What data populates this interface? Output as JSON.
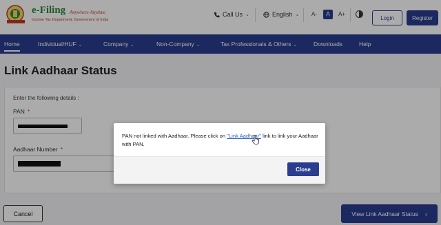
{
  "header": {
    "logo_title": "e-Filing",
    "logo_tagline": "Anywhere Anytime",
    "logo_subtitle": "Income Tax Department, Government of India",
    "call_us": "Call Us",
    "language": "English",
    "font_decrease": "A-",
    "font_normal": "A",
    "font_increase": "A+",
    "login": "Login",
    "register": "Register"
  },
  "nav": {
    "items": [
      {
        "label": "Home",
        "has_menu": false
      },
      {
        "label": "Individual/HUF",
        "has_menu": true
      },
      {
        "label": "Company",
        "has_menu": true
      },
      {
        "label": "Non-Company",
        "has_menu": true
      },
      {
        "label": "Tax Professionals & Others",
        "has_menu": true
      },
      {
        "label": "Downloads",
        "has_menu": false
      },
      {
        "label": "Help",
        "has_menu": false
      }
    ]
  },
  "page": {
    "title": "Link Aadhaar Status",
    "intro": "Enter the following details :",
    "pan_label": "PAN",
    "aadhaar_label": "Aadhaar Number",
    "required_mark": "*",
    "cancel": "Cancel",
    "view_status": "View Link Aadhaar Status",
    "view_status_arrow": "›"
  },
  "modal": {
    "message_before": "PAN not linked with Aadhaar. Please click on ",
    "link_text": "\"Link Aadhaar\"",
    "message_after": " link to link your Aadhaar with PAN.",
    "close": "Close"
  },
  "colors": {
    "primary": "#2b3d8f",
    "link": "#2b5ec9",
    "required": "#d32f2f",
    "logo_green": "#2b8a3e",
    "logo_red": "#c0392b"
  },
  "icons": [
    "emblem-logo",
    "phone-icon",
    "globe-icon",
    "chevron-down-icon",
    "contrast-icon",
    "chevron-right-icon",
    "pointer-cursor-icon"
  ]
}
